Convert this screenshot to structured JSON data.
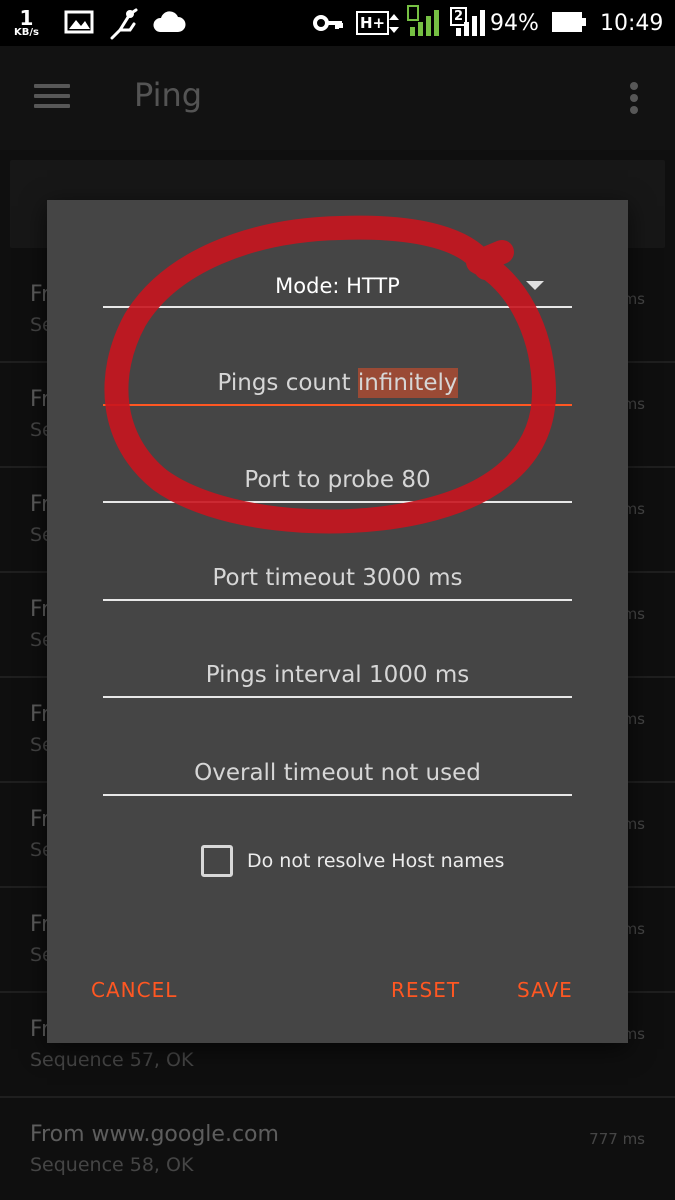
{
  "status_bar": {
    "net_speed_value": "1",
    "net_speed_unit": "KB/s",
    "sim1_label": "H+",
    "sim2_label": "2",
    "battery_pct": "94%",
    "time": "10:49",
    "icons": [
      "image-icon",
      "usb-debug-icon",
      "cloud-icon",
      "vpn-key-icon",
      "signal-icon",
      "battery-icon"
    ]
  },
  "app_bar": {
    "title": "Ping"
  },
  "results": [
    {
      "from": "Fr",
      "seq": "Se",
      "ms": "ms"
    },
    {
      "from": "Fr",
      "seq": "Se",
      "ms": "ms"
    },
    {
      "from": "Fr",
      "seq": "Se",
      "ms": "ms"
    },
    {
      "from": "Fr",
      "seq": "Se",
      "ms": "ms"
    },
    {
      "from": "Fr",
      "seq": "Se",
      "ms": "ms"
    },
    {
      "from": "Fr",
      "seq": "Se",
      "ms": "ms"
    },
    {
      "from": "Fr",
      "seq": "Se",
      "ms": "ms"
    },
    {
      "from": "Fr",
      "seq": "Sequence 57, OK",
      "ms": "ms"
    },
    {
      "from": "From www.google.com",
      "seq": "Sequence 58, OK",
      "ms": "777 ms"
    }
  ],
  "dialog": {
    "mode_label": "Mode: HTTP",
    "pings_count_prefix": "Pings count ",
    "pings_count_value": "infinitely",
    "port_to_probe": "Port to probe 80",
    "port_timeout": "Port timeout 3000 ms",
    "pings_interval": "Pings interval 1000 ms",
    "overall_timeout": "Overall timeout not used",
    "checkbox_label": "Do not resolve Host names",
    "checkbox_checked": false,
    "cancel_label": "CANCEL",
    "reset_label": "RESET",
    "save_label": "SAVE"
  },
  "colors": {
    "accent": "#ff5722",
    "annotation": "#c8141e",
    "dialog_bg": "#454545",
    "status_green": "#76c043"
  }
}
